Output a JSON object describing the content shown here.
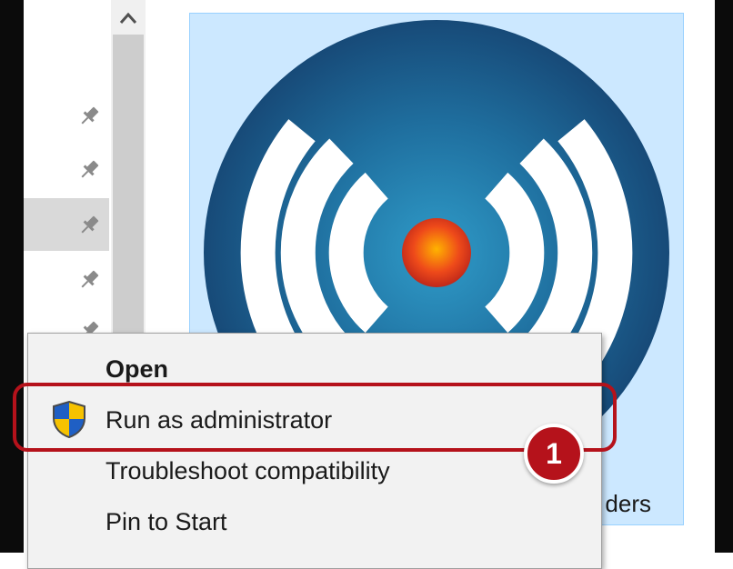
{
  "explorer": {
    "file_name": "ders",
    "nav_pin_icon": "pin-icon",
    "scroll_up_icon": "chevron-up-icon",
    "app_icon": "wireless-signal-icon"
  },
  "context_menu": {
    "items": [
      {
        "label": "Open",
        "bold": true
      },
      {
        "label": "Run as administrator",
        "icon": "uac-shield-icon"
      },
      {
        "label": "Troubleshoot compatibility"
      },
      {
        "label": "Pin to Start"
      }
    ]
  },
  "callout": {
    "step_number": "1",
    "color": "#b5121b"
  },
  "colors": {
    "selection_fill": "#cce8ff",
    "selection_border": "#99d1ff",
    "menu_background": "#f2f2f2",
    "icon_blue": "#1f5f8f"
  }
}
